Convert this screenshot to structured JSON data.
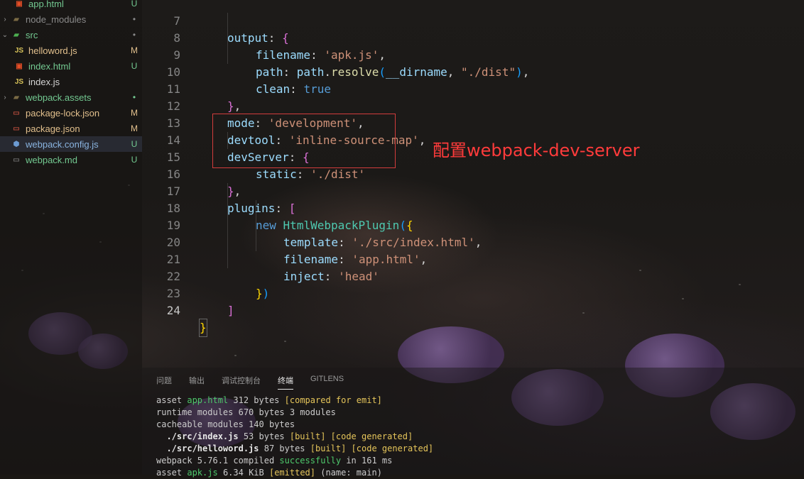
{
  "sidebar": {
    "items": [
      {
        "name": "app.html",
        "icon": "html-file-icon",
        "status": "U"
      },
      {
        "name": "node_modules",
        "icon": "folder-icon",
        "status": "•"
      },
      {
        "name": "src",
        "icon": "folder-icon",
        "status": "•"
      },
      {
        "name": "helloword.js",
        "icon": "js-file-icon",
        "status": "M"
      },
      {
        "name": "index.html",
        "icon": "html-file-icon",
        "status": "U"
      },
      {
        "name": "index.js",
        "icon": "js-file-icon",
        "status": ""
      },
      {
        "name": "webpack.assets",
        "icon": "folder-icon",
        "status": "•"
      },
      {
        "name": "package-lock.json",
        "icon": "json-file-icon",
        "status": "M"
      },
      {
        "name": "package.json",
        "icon": "json-file-icon",
        "status": "M"
      },
      {
        "name": "webpack.config.js",
        "icon": "config-file-icon",
        "status": "U"
      },
      {
        "name": "webpack.md",
        "icon": "markdown-file-icon",
        "status": "U"
      }
    ],
    "js_badge": "JS",
    "chevron_collapsed": "›",
    "chevron_expanded": "⌄"
  },
  "editor": {
    "line_numbers": [
      "7",
      "8",
      "9",
      "10",
      "11",
      "12",
      "13",
      "14",
      "15",
      "16",
      "17",
      "18",
      "19",
      "20",
      "21",
      "22",
      "23",
      "24"
    ],
    "code": {
      "l7_key": "output",
      "l7_punc": ": ",
      "l7_brace": "{",
      "l8_key": "filename",
      "l8_punc": ": ",
      "l8_str": "'apk.js'",
      "l8_end": ",",
      "l9_key": "path",
      "l9_punc": ": ",
      "l9_obj": "path",
      "l9_dot": ".",
      "l9_fn": "resolve",
      "l9_open": "(",
      "l9_arg": "__dirname",
      "l9_comma": ", ",
      "l9_str": "\"./dist\"",
      "l9_close": ")",
      "l9_end": ",",
      "l10_key": "clean",
      "l10_punc": ": ",
      "l10_val": "true",
      "l11_brace": "}",
      "l11_end": ",",
      "l12_key": "mode",
      "l12_punc": ": ",
      "l12_str": "'development'",
      "l12_end": ",",
      "l13_key": "devtool",
      "l13_punc": ": ",
      "l13_str": "'inline-source-map'",
      "l13_end": ",",
      "l14_key": "devServer",
      "l14_punc": ": ",
      "l14_brace": "{",
      "l15_key": "static",
      "l15_punc": ": ",
      "l15_str": "'./dist'",
      "l16_brace": "}",
      "l16_end": ",",
      "l17_key": "plugins",
      "l17_punc": ": ",
      "l17_bracket": "[",
      "l18_kw": "new",
      "l18_cls": "HtmlWebpackPlugin",
      "l18_open": "(",
      "l18_brace": "{",
      "l19_key": "template",
      "l19_punc": ": ",
      "l19_str": "'./src/index.html'",
      "l19_end": ",",
      "l20_key": "filename",
      "l20_punc": ": ",
      "l20_str": "'app.html'",
      "l20_end": ",",
      "l21_key": "inject",
      "l21_punc": ": ",
      "l21_str": "'head'",
      "l22_brace": "}",
      "l22_close": ")",
      "l23_bracket": "]",
      "l24_brace": "}"
    },
    "annotation": "配置webpack-dev-server"
  },
  "panel": {
    "tabs": [
      "问题",
      "输出",
      "调试控制台",
      "终端",
      "GITLENS"
    ],
    "active_tab": "终端",
    "terminal": {
      "l1_a": "asset ",
      "l1_b": "app.html",
      "l1_c": " 312 bytes ",
      "l1_d": "[compared for emit]",
      "l2": "runtime modules 670 bytes 3 modules",
      "l3": "cacheable modules 140 bytes",
      "l4_a": "  ./src/index.js",
      "l4_b": " 53 bytes ",
      "l4_c": "[built] [code generated]",
      "l5_a": "  ./src/helloword.js",
      "l5_b": " 87 bytes ",
      "l5_c": "[built] [code generated]",
      "l6_a": "webpack 5.76.1 compiled ",
      "l6_b": "successfully",
      "l6_c": " in 161 ms",
      "l7_a": "asset ",
      "l7_b": "apk.js",
      "l7_c": " 6.34 KiB ",
      "l7_d": "[emitted]",
      "l7_e": " (name: main)"
    }
  },
  "colors": {
    "annotation": "#ff3b3b",
    "highlight_border": "#d33c3c",
    "git_untracked": "#73c991",
    "git_modified": "#e2c08d"
  }
}
